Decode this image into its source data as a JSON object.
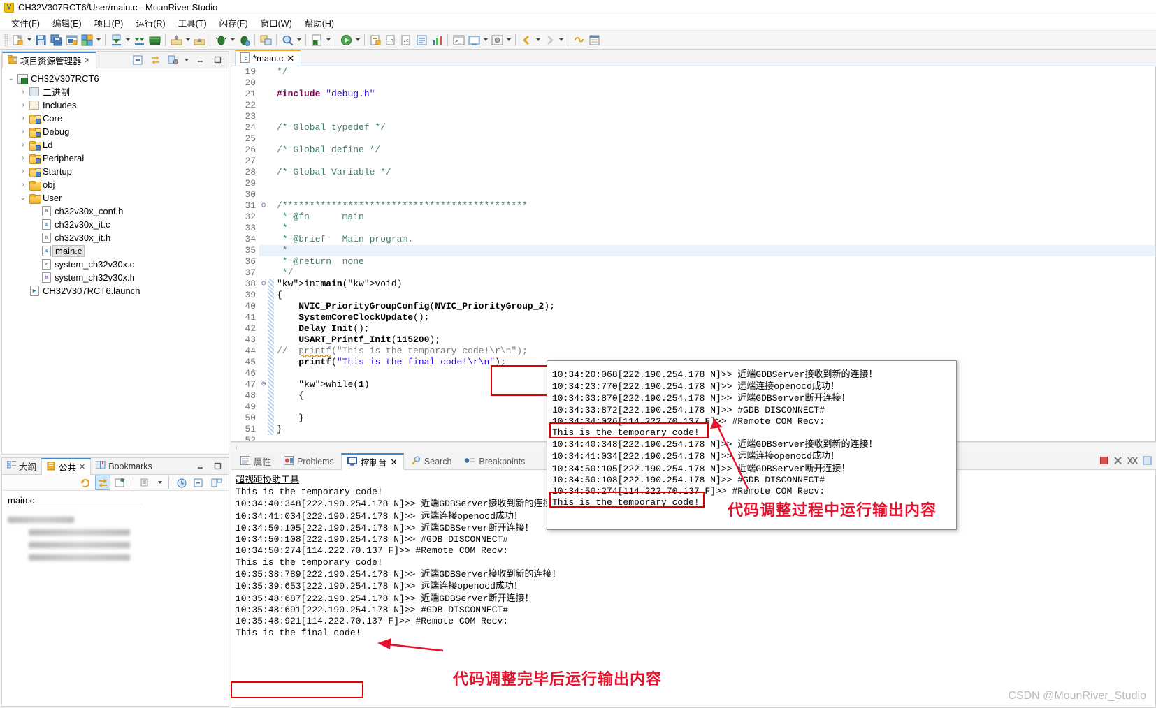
{
  "window": {
    "title": "CH32V307RCT6/User/main.c - MounRiver Studio",
    "logo_text": "V"
  },
  "menu": {
    "items": [
      {
        "label": "文件(F)",
        "name": "menu-file"
      },
      {
        "label": "编辑(E)",
        "name": "menu-edit"
      },
      {
        "label": "项目(P)",
        "name": "menu-project"
      },
      {
        "label": "运行(R)",
        "name": "menu-run"
      },
      {
        "label": "工具(T)",
        "name": "menu-tools"
      },
      {
        "label": "闪存(F)",
        "name": "menu-flash"
      },
      {
        "label": "窗口(W)",
        "name": "menu-window"
      },
      {
        "label": "帮助(H)",
        "name": "menu-help"
      }
    ]
  },
  "explorer": {
    "tab_label": "项目资源管理器",
    "close_glyph": "✕",
    "tree": [
      {
        "label": "CH32V307RCT6",
        "indent": 0,
        "twist": "v",
        "icon": "project-icon"
      },
      {
        "label": "二进制",
        "indent": 1,
        "twist": ">",
        "icon": "binaries-icon"
      },
      {
        "label": "Includes",
        "indent": 1,
        "twist": ">",
        "icon": "includes-icon"
      },
      {
        "label": "Core",
        "indent": 1,
        "twist": ">",
        "icon": "source-folder-icon"
      },
      {
        "label": "Debug",
        "indent": 1,
        "twist": ">",
        "icon": "source-folder-icon"
      },
      {
        "label": "Ld",
        "indent": 1,
        "twist": ">",
        "icon": "source-folder-icon"
      },
      {
        "label": "Peripheral",
        "indent": 1,
        "twist": ">",
        "icon": "source-folder-icon"
      },
      {
        "label": "Startup",
        "indent": 1,
        "twist": ">",
        "icon": "source-folder-icon"
      },
      {
        "label": "obj",
        "indent": 1,
        "twist": ">",
        "icon": "folder-icon"
      },
      {
        "label": "User",
        "indent": 1,
        "twist": "v",
        "icon": "folder-icon"
      },
      {
        "label": "ch32v30x_conf.h",
        "indent": 2,
        "twist": "",
        "icon": "h-file-icon"
      },
      {
        "label": "ch32v30x_it.c",
        "indent": 2,
        "twist": "",
        "icon": "c-file-icon"
      },
      {
        "label": "ch32v30x_it.h",
        "indent": 2,
        "twist": "",
        "icon": "h-file-icon"
      },
      {
        "label": "main.c",
        "indent": 2,
        "twist": "",
        "icon": "c-file-icon",
        "selected": true
      },
      {
        "label": "system_ch32v30x.c",
        "indent": 2,
        "twist": "",
        "icon": "c-file-icon"
      },
      {
        "label": "system_ch32v30x.h",
        "indent": 2,
        "twist": "",
        "icon": "h-file-icon"
      },
      {
        "label": "CH32V307RCT6.launch",
        "indent": 1,
        "twist": "",
        "icon": "launch-file-icon"
      }
    ]
  },
  "outline_view": {
    "tabs": [
      {
        "label": "大纲",
        "active": false,
        "name": "tab-outline"
      },
      {
        "label": "公共",
        "active": true,
        "name": "tab-common"
      },
      {
        "label": "Bookmarks",
        "active": false,
        "name": "tab-bookmarks"
      }
    ],
    "close_glyph": "✕",
    "file_label": "main.c"
  },
  "editor": {
    "tab_label": "*main.c",
    "close_glyph": "✕",
    "lines": [
      {
        "n": "19",
        "fold": "",
        "bar": false,
        "html": "*/",
        "cls": "cmt"
      },
      {
        "n": "20",
        "fold": "",
        "bar": false,
        "html": "",
        "cls": ""
      },
      {
        "n": "21",
        "fold": "",
        "bar": false,
        "html": "#include \"debug.h\"",
        "cls": "include"
      },
      {
        "n": "22",
        "fold": "",
        "bar": false,
        "html": "",
        "cls": ""
      },
      {
        "n": "23",
        "fold": "",
        "bar": false,
        "html": "",
        "cls": ""
      },
      {
        "n": "24",
        "fold": "",
        "bar": false,
        "html": "/* Global typedef */",
        "cls": "cmt"
      },
      {
        "n": "25",
        "fold": "",
        "bar": false,
        "html": "",
        "cls": ""
      },
      {
        "n": "26",
        "fold": "",
        "bar": false,
        "html": "/* Global define */",
        "cls": "cmt"
      },
      {
        "n": "27",
        "fold": "",
        "bar": false,
        "html": "",
        "cls": ""
      },
      {
        "n": "28",
        "fold": "",
        "bar": false,
        "html": "/* Global Variable */",
        "cls": "cmt"
      },
      {
        "n": "29",
        "fold": "",
        "bar": false,
        "html": "",
        "cls": ""
      },
      {
        "n": "30",
        "fold": "",
        "bar": false,
        "html": "",
        "cls": ""
      },
      {
        "n": "31",
        "fold": "-",
        "bar": false,
        "html": "/*********************************************",
        "cls": "cmt"
      },
      {
        "n": "32",
        "fold": "",
        "bar": false,
        "html": " * @fn      main",
        "cls": "cmt"
      },
      {
        "n": "33",
        "fold": "",
        "bar": false,
        "html": " *",
        "cls": "cmt"
      },
      {
        "n": "34",
        "fold": "",
        "bar": false,
        "html": " * @brief   Main program.",
        "cls": "cmt"
      },
      {
        "n": "35",
        "fold": "",
        "bar": false,
        "html": " *",
        "cls": "cmt"
      },
      {
        "n": "36",
        "fold": "",
        "bar": false,
        "html": " * @return  none",
        "cls": "cmt"
      },
      {
        "n": "37",
        "fold": "",
        "bar": false,
        "html": " */",
        "cls": "cmt"
      },
      {
        "n": "38",
        "fold": "-",
        "bar": true,
        "html": "int main(void)",
        "cls": "code"
      },
      {
        "n": "39",
        "fold": "",
        "bar": true,
        "html": "{",
        "cls": "code"
      },
      {
        "n": "40",
        "fold": "",
        "bar": true,
        "html": "    NVIC_PriorityGroupConfig(NVIC_PriorityGroup_2);",
        "cls": "code"
      },
      {
        "n": "41",
        "fold": "",
        "bar": true,
        "html": "    SystemCoreClockUpdate();",
        "cls": "code"
      },
      {
        "n": "42",
        "fold": "",
        "bar": true,
        "html": "    Delay_Init();",
        "cls": "code"
      },
      {
        "n": "43",
        "fold": "",
        "bar": true,
        "html": "    USART_Printf_Init(115200);",
        "cls": "code"
      },
      {
        "n": "44",
        "fold": "",
        "bar": true,
        "html": "//  printf(\"This is the temporary code!\\r\\n\");",
        "cls": "commented"
      },
      {
        "n": "45",
        "fold": "",
        "bar": true,
        "html": "    printf(\"This is the final code!\\r\\n\");",
        "cls": "code"
      },
      {
        "n": "46",
        "fold": "",
        "bar": true,
        "html": "",
        "cls": ""
      },
      {
        "n": "47",
        "fold": "-",
        "bar": true,
        "html": "    while(1)",
        "cls": "code"
      },
      {
        "n": "48",
        "fold": "",
        "bar": true,
        "html": "    {",
        "cls": "code"
      },
      {
        "n": "49",
        "fold": "",
        "bar": true,
        "html": "",
        "cls": ""
      },
      {
        "n": "50",
        "fold": "",
        "bar": true,
        "html": "    }",
        "cls": "code"
      },
      {
        "n": "51",
        "fold": "",
        "bar": true,
        "html": "}",
        "cls": "code"
      },
      {
        "n": "52",
        "fold": "",
        "bar": false,
        "html": "",
        "cls": ""
      }
    ]
  },
  "bottom_panel": {
    "tabs": [
      {
        "label": "属性",
        "active": false,
        "name": "tab-properties"
      },
      {
        "label": "Problems",
        "active": false,
        "name": "tab-problems"
      },
      {
        "label": "控制台",
        "active": true,
        "name": "tab-console"
      },
      {
        "label": "Search",
        "active": false,
        "name": "tab-search"
      },
      {
        "label": "Breakpoints",
        "active": false,
        "name": "tab-breakpoints"
      }
    ],
    "close_glyph": "✕",
    "console_title": "超视距协助工具",
    "console_lines": [
      "This is the temporary code!",
      "10:34:40:348[222.190.254.178 N]>> 近端GDBServer接收到新的连接！",
      "10:34:41:034[222.190.254.178 N]>> 远端连接openocd成功！",
      "10:34:50:105[222.190.254.178 N]>> 近端GDBServer断开连接！",
      "10:34:50:108[222.190.254.178 N]>> #GDB DISCONNECT#",
      "10:34:50:274[114.222.70.137 F]>> #Remote COM Recv:",
      "This is the temporary code!",
      "10:35:38:789[222.190.254.178 N]>> 近端GDBServer接收到新的连接！",
      "10:35:39:653[222.190.254.178 N]>> 远端连接openocd成功！",
      "10:35:48:687[222.190.254.178 N]>> 近端GDBServer断开连接！",
      "10:35:48:691[222.190.254.178 N]>> #GDB DISCONNECT#",
      "10:35:48:921[114.222.70.137 F]>> #Remote COM Recv:",
      "This is the final code!"
    ]
  },
  "popup_console": {
    "lines": [
      "10:34:20:068[222.190.254.178 N]>> 近端GDBServer接收到新的连接！",
      "10:34:23:770[222.190.254.178 N]>> 远端连接openocd成功！",
      "10:34:33:870[222.190.254.178 N]>> 近端GDBServer断开连接！",
      "10:34:33:872[222.190.254.178 N]>> #GDB DISCONNECT#",
      "10:34:34:026[114.222.70.137 F]>> #Remote COM Recv:",
      "This is the temporary code!",
      "10:34:40:348[222.190.254.178 N]>> 近端GDBServer接收到新的连接！",
      "10:34:41:034[222.190.254.178 N]>> 远端连接openocd成功！",
      "10:34:50:105[222.190.254.178 N]>> 近端GDBServer断开连接！",
      "10:34:50:108[222.190.254.178 N]>> #GDB DISCONNECT#",
      "10:34:50:274[114.222.70.137 F]>> #Remote COM Recv:",
      "This is the temporary code!"
    ]
  },
  "annotations": {
    "top": "代码调整过程中运行输出内容",
    "bottom": "代码调整完毕后运行输出内容",
    "color": "#e8112d"
  },
  "watermark": "CSDN @MounRiver_Studio"
}
